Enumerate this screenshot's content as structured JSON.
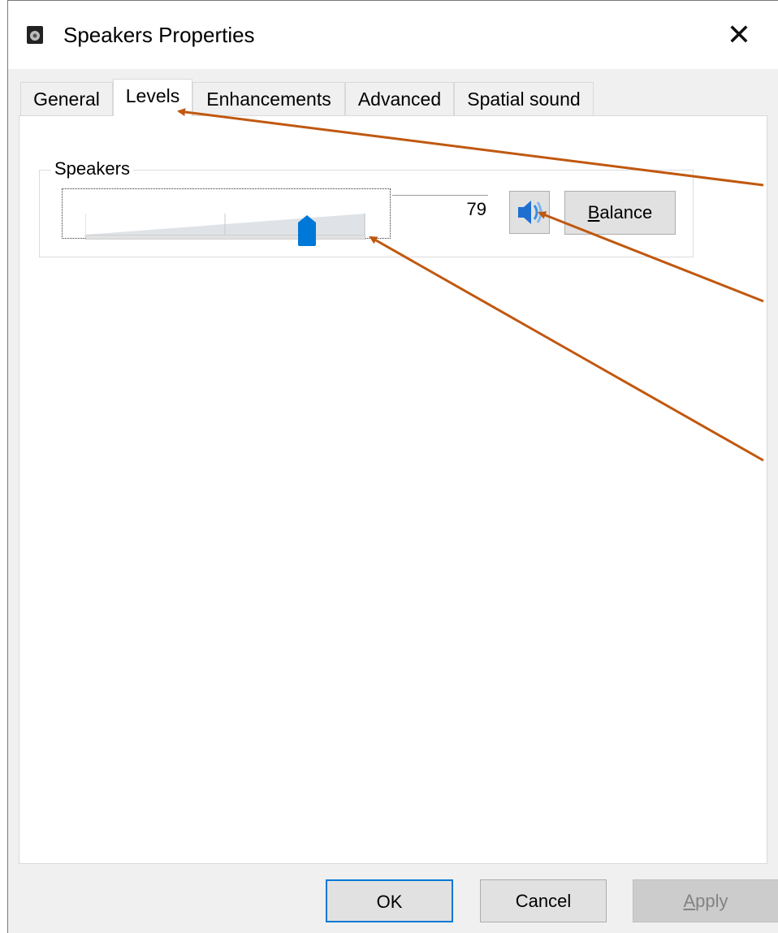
{
  "window": {
    "title": "Speakers Properties",
    "close_glyph": "✕"
  },
  "tabs": [
    {
      "label": "General",
      "active": false
    },
    {
      "label": "Levels",
      "active": true
    },
    {
      "label": "Enhancements",
      "active": false
    },
    {
      "label": "Advanced",
      "active": false
    },
    {
      "label": "Spatial sound",
      "active": false
    }
  ],
  "levels": {
    "group_label": "Speakers",
    "volume_value": "79",
    "volume_fraction": 0.79,
    "mute_icon": "speaker-icon",
    "balance_label_underlined": "B",
    "balance_label_rest": "alance"
  },
  "footer": {
    "ok_label": "OK",
    "cancel_label": "Cancel",
    "apply_label_underlined": "A",
    "apply_label_rest": "pply"
  },
  "colors": {
    "accent": "#0078d7",
    "annotation_arrow": "#c0580f"
  }
}
